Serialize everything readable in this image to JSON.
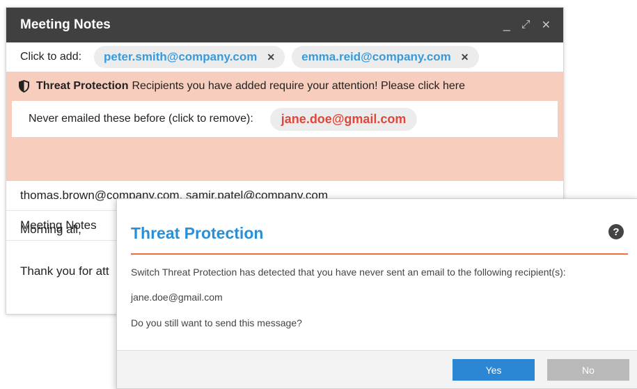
{
  "compose": {
    "title": "Meeting Notes",
    "controls": {
      "minimize": "_",
      "expand": "⤢",
      "close": "✕"
    },
    "click_to_add_label": "Click to add:",
    "suggested": [
      {
        "email": "peter.smith@company.com",
        "remove": "✕"
      },
      {
        "email": "emma.reid@company.com",
        "remove": "✕"
      }
    ],
    "banner": {
      "title": "Threat Protection",
      "message": "Recipients you have added require your attention! Please click here",
      "never_label": "Never emailed these before (click to remove):",
      "never_email": "jane.doe@gmail.com"
    },
    "to": "thomas.brown@company.com, samir.patel@company.com",
    "subject": "Meeting Notes",
    "body_line1": "Morning all,",
    "body_line2": "Thank you for att"
  },
  "dialog": {
    "title": "Threat Protection",
    "help": "?",
    "message": "Switch Threat Protection has detected that you have never sent an email to the following recipient(s):",
    "recipient": "jane.doe@gmail.com",
    "question": "Do you still want to send this message?",
    "yes_label": "Yes",
    "no_label": "No"
  },
  "colors": {
    "titlebar": "#404040",
    "banner": "#f7cdbd",
    "accent_blue": "#2a8fd4",
    "warning_red": "#e0463a",
    "rule_orange": "#ee6f35"
  }
}
